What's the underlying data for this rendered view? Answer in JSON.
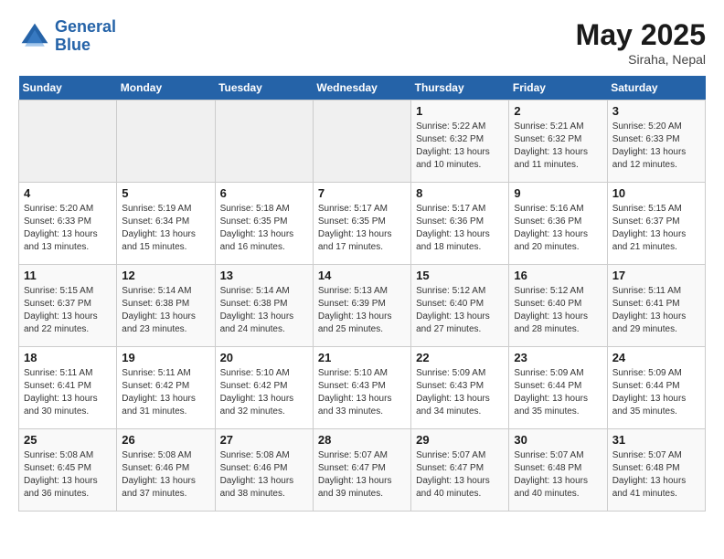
{
  "logo": {
    "line1": "General",
    "line2": "Blue"
  },
  "title": "May 2025",
  "location": "Siraha, Nepal",
  "days_header": [
    "Sunday",
    "Monday",
    "Tuesday",
    "Wednesday",
    "Thursday",
    "Friday",
    "Saturday"
  ],
  "weeks": [
    [
      {
        "day": "",
        "content": ""
      },
      {
        "day": "",
        "content": ""
      },
      {
        "day": "",
        "content": ""
      },
      {
        "day": "",
        "content": ""
      },
      {
        "day": "1",
        "content": "Sunrise: 5:22 AM\nSunset: 6:32 PM\nDaylight: 13 hours\nand 10 minutes."
      },
      {
        "day": "2",
        "content": "Sunrise: 5:21 AM\nSunset: 6:32 PM\nDaylight: 13 hours\nand 11 minutes."
      },
      {
        "day": "3",
        "content": "Sunrise: 5:20 AM\nSunset: 6:33 PM\nDaylight: 13 hours\nand 12 minutes."
      }
    ],
    [
      {
        "day": "4",
        "content": "Sunrise: 5:20 AM\nSunset: 6:33 PM\nDaylight: 13 hours\nand 13 minutes."
      },
      {
        "day": "5",
        "content": "Sunrise: 5:19 AM\nSunset: 6:34 PM\nDaylight: 13 hours\nand 15 minutes."
      },
      {
        "day": "6",
        "content": "Sunrise: 5:18 AM\nSunset: 6:35 PM\nDaylight: 13 hours\nand 16 minutes."
      },
      {
        "day": "7",
        "content": "Sunrise: 5:17 AM\nSunset: 6:35 PM\nDaylight: 13 hours\nand 17 minutes."
      },
      {
        "day": "8",
        "content": "Sunrise: 5:17 AM\nSunset: 6:36 PM\nDaylight: 13 hours\nand 18 minutes."
      },
      {
        "day": "9",
        "content": "Sunrise: 5:16 AM\nSunset: 6:36 PM\nDaylight: 13 hours\nand 20 minutes."
      },
      {
        "day": "10",
        "content": "Sunrise: 5:15 AM\nSunset: 6:37 PM\nDaylight: 13 hours\nand 21 minutes."
      }
    ],
    [
      {
        "day": "11",
        "content": "Sunrise: 5:15 AM\nSunset: 6:37 PM\nDaylight: 13 hours\nand 22 minutes."
      },
      {
        "day": "12",
        "content": "Sunrise: 5:14 AM\nSunset: 6:38 PM\nDaylight: 13 hours\nand 23 minutes."
      },
      {
        "day": "13",
        "content": "Sunrise: 5:14 AM\nSunset: 6:38 PM\nDaylight: 13 hours\nand 24 minutes."
      },
      {
        "day": "14",
        "content": "Sunrise: 5:13 AM\nSunset: 6:39 PM\nDaylight: 13 hours\nand 25 minutes."
      },
      {
        "day": "15",
        "content": "Sunrise: 5:12 AM\nSunset: 6:40 PM\nDaylight: 13 hours\nand 27 minutes."
      },
      {
        "day": "16",
        "content": "Sunrise: 5:12 AM\nSunset: 6:40 PM\nDaylight: 13 hours\nand 28 minutes."
      },
      {
        "day": "17",
        "content": "Sunrise: 5:11 AM\nSunset: 6:41 PM\nDaylight: 13 hours\nand 29 minutes."
      }
    ],
    [
      {
        "day": "18",
        "content": "Sunrise: 5:11 AM\nSunset: 6:41 PM\nDaylight: 13 hours\nand 30 minutes."
      },
      {
        "day": "19",
        "content": "Sunrise: 5:11 AM\nSunset: 6:42 PM\nDaylight: 13 hours\nand 31 minutes."
      },
      {
        "day": "20",
        "content": "Sunrise: 5:10 AM\nSunset: 6:42 PM\nDaylight: 13 hours\nand 32 minutes."
      },
      {
        "day": "21",
        "content": "Sunrise: 5:10 AM\nSunset: 6:43 PM\nDaylight: 13 hours\nand 33 minutes."
      },
      {
        "day": "22",
        "content": "Sunrise: 5:09 AM\nSunset: 6:43 PM\nDaylight: 13 hours\nand 34 minutes."
      },
      {
        "day": "23",
        "content": "Sunrise: 5:09 AM\nSunset: 6:44 PM\nDaylight: 13 hours\nand 35 minutes."
      },
      {
        "day": "24",
        "content": "Sunrise: 5:09 AM\nSunset: 6:44 PM\nDaylight: 13 hours\nand 35 minutes."
      }
    ],
    [
      {
        "day": "25",
        "content": "Sunrise: 5:08 AM\nSunset: 6:45 PM\nDaylight: 13 hours\nand 36 minutes."
      },
      {
        "day": "26",
        "content": "Sunrise: 5:08 AM\nSunset: 6:46 PM\nDaylight: 13 hours\nand 37 minutes."
      },
      {
        "day": "27",
        "content": "Sunrise: 5:08 AM\nSunset: 6:46 PM\nDaylight: 13 hours\nand 38 minutes."
      },
      {
        "day": "28",
        "content": "Sunrise: 5:07 AM\nSunset: 6:47 PM\nDaylight: 13 hours\nand 39 minutes."
      },
      {
        "day": "29",
        "content": "Sunrise: 5:07 AM\nSunset: 6:47 PM\nDaylight: 13 hours\nand 40 minutes."
      },
      {
        "day": "30",
        "content": "Sunrise: 5:07 AM\nSunset: 6:48 PM\nDaylight: 13 hours\nand 40 minutes."
      },
      {
        "day": "31",
        "content": "Sunrise: 5:07 AM\nSunset: 6:48 PM\nDaylight: 13 hours\nand 41 minutes."
      }
    ]
  ]
}
